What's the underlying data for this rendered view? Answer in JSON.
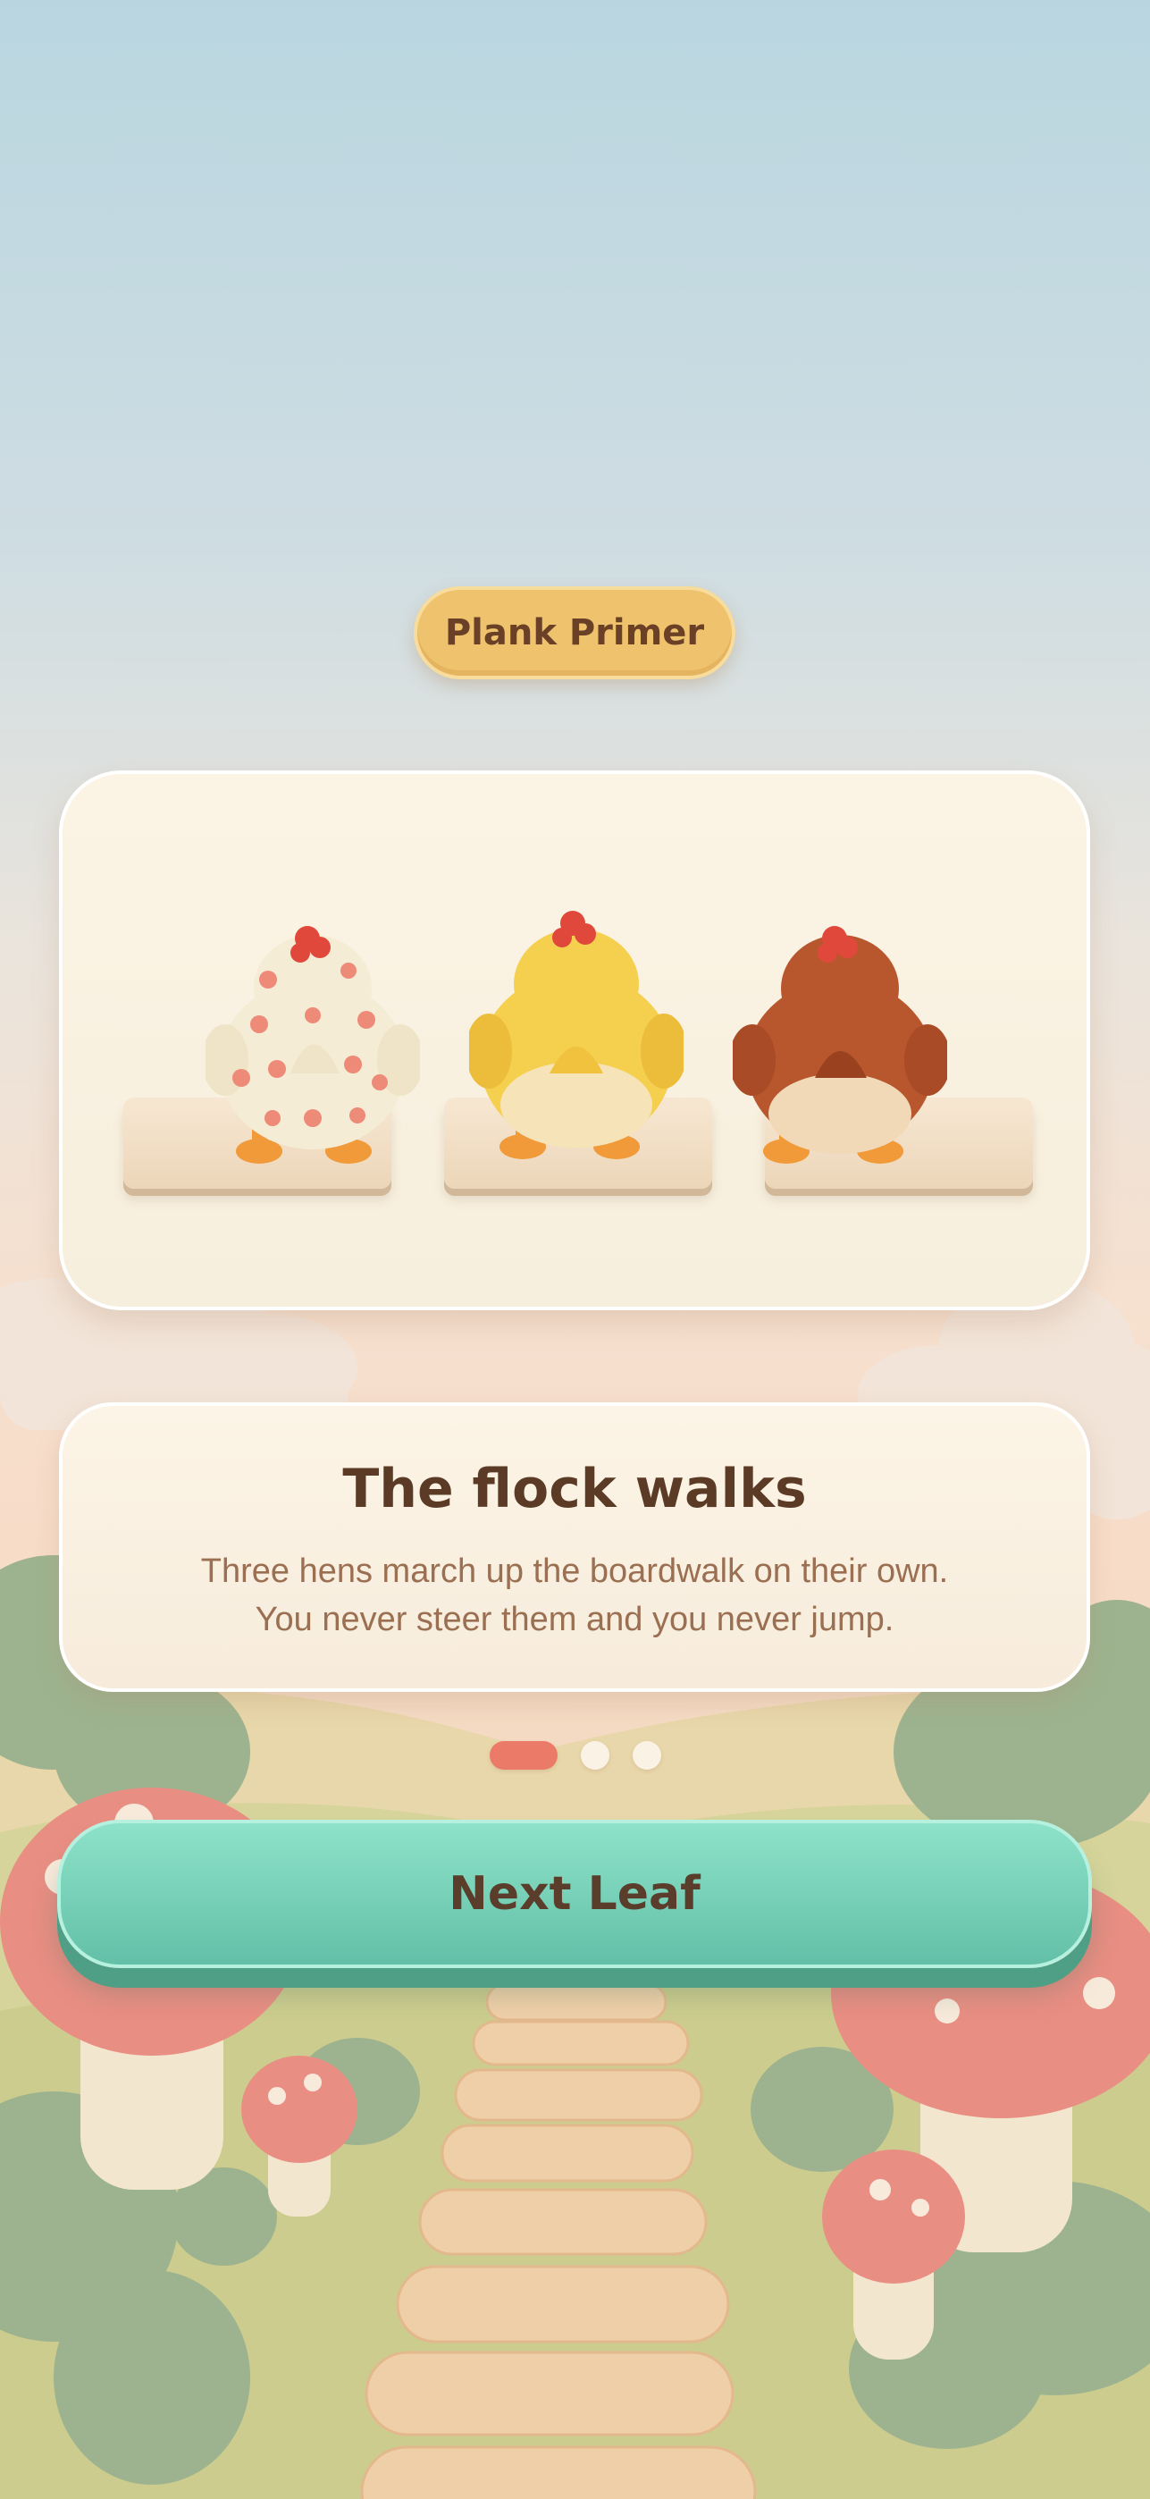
{
  "badge": {
    "label": "Plank Primer"
  },
  "info": {
    "title": "The flock walks",
    "body_line1": "Three hens march up the boardwalk on their own.",
    "body_line2": "You never steer them and you never jump."
  },
  "pagination": {
    "total": 3,
    "active": 1
  },
  "button": {
    "label": "Next Leaf"
  },
  "hens": [
    {
      "name": "speckled-hen",
      "body_color": "#f5ecd6",
      "spot_color": "#ee8a78"
    },
    {
      "name": "yellow-hen",
      "body_color": "#f5cf4e"
    },
    {
      "name": "brown-hen",
      "body_color": "#b8572e"
    }
  ],
  "colors": {
    "accent": "#ec7a68",
    "button": "#6ecdb3",
    "badge": "#efc26e",
    "text_dark": "#5b3b26",
    "text_muted": "#9a6f52"
  }
}
